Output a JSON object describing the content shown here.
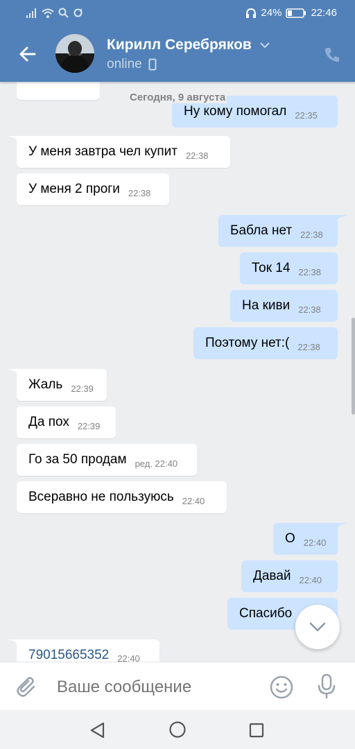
{
  "status_bar": {
    "battery": "24%",
    "time": "22:46"
  },
  "header": {
    "contact_name": "Кирилл Серебряков",
    "status": "online"
  },
  "chat": {
    "date_separator": "Сегодня, 9 августа",
    "messages": [
      {
        "dir": "out",
        "text": "Ну кому помогал",
        "time": "22:35"
      },
      {
        "dir": "in",
        "text": "У меня завтра чел купит",
        "time": "22:38"
      },
      {
        "dir": "in",
        "text": "У меня 2 проги",
        "time": "22:38"
      },
      {
        "dir": "out",
        "text": "Бабла нет",
        "time": "22:38"
      },
      {
        "dir": "out",
        "text": "Ток 14",
        "time": "22:38"
      },
      {
        "dir": "out",
        "text": "На киви",
        "time": "22:38"
      },
      {
        "dir": "out",
        "text": "Поэтому нет:(",
        "time": "22:38"
      },
      {
        "dir": "in",
        "text": "Жаль",
        "time": "22:39"
      },
      {
        "dir": "in",
        "text": "Да пох",
        "time": "22:39"
      },
      {
        "dir": "in",
        "text": "Го за 50 продам",
        "time": "ред. 22:40"
      },
      {
        "dir": "in",
        "text": "Всеравно не пользуюсь",
        "time": "22:40"
      },
      {
        "dir": "out",
        "text": "О",
        "time": "22:40"
      },
      {
        "dir": "out",
        "text": "Давай",
        "time": "22:40"
      },
      {
        "dir": "out",
        "text": "Спасибо",
        "time": ""
      },
      {
        "dir": "in",
        "text": "79015665352",
        "time": "22:40"
      }
    ]
  },
  "composer": {
    "placeholder": "Ваше сообщение"
  },
  "colors": {
    "header_bg": "#5181b8",
    "incoming_bubble": "#ffffff",
    "outgoing_bubble": "#cce4ff",
    "chat_bg": "#edeef0",
    "link": "#2a5885"
  },
  "icons": {
    "back": "arrow-left-icon",
    "dropdown": "chevron-down-icon",
    "call": "phone-icon",
    "attach": "paperclip-icon",
    "emoji": "smile-icon",
    "voice": "microphone-icon",
    "scroll_down": "chevron-down-icon"
  }
}
